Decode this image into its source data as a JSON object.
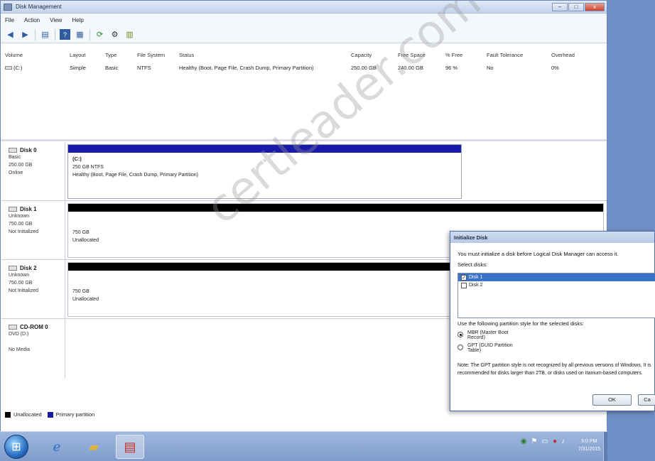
{
  "window": {
    "title": "Disk Management",
    "controls": {
      "minimize": "–",
      "maximize": "□",
      "close": "x"
    }
  },
  "menu": [
    "File",
    "Action",
    "View",
    "Help"
  ],
  "toolbar_icons": [
    "back-arrow-icon",
    "forward-arrow-icon",
    "console-tree-icon",
    "help-icon",
    "properties-icon",
    "refresh-icon",
    "settings-icon",
    "wizard-icon"
  ],
  "volumes": {
    "columns": [
      "Volume",
      "Layout",
      "Type",
      "File System",
      "Status",
      "Capacity",
      "Free Space",
      "% Free",
      "Fault Tolerance",
      "Overhead"
    ],
    "rows": [
      [
        "(C:)",
        "Simple",
        "Basic",
        "NTFS",
        "Healthy (Boot, Page File, Crash Dump, Primary Partition)",
        "250.00 GB",
        "240.00 GB",
        "96 %",
        "No",
        "0%"
      ]
    ]
  },
  "disks": [
    {
      "name": "Disk 0",
      "lines": [
        "Basic",
        "250.00 GB",
        "Online"
      ],
      "partition": {
        "title": "(C:)",
        "size": "250 GB NTFS",
        "status": "Healthy (Boot, Page File, Crash Dump, Primary Partition)"
      }
    },
    {
      "name": "Disk 1",
      "lines": [
        "Unknown",
        "750.00 GB",
        "Not Initialized"
      ],
      "partition": {
        "size": "750 GB",
        "status": "Unallocated"
      }
    },
    {
      "name": "Disk 2",
      "lines": [
        "Unknown",
        "750.00 GB",
        "Not Initialized"
      ],
      "partition": {
        "size": "750 GB",
        "status": "Unallocated"
      }
    },
    {
      "name": "CD-ROM 0",
      "lines": [
        "DVD (D:)",
        "",
        "No Media"
      ]
    }
  ],
  "legend": {
    "unallocated": "Unallocated",
    "primary": "Primary partition",
    "colors": {
      "unallocated": "#000000",
      "primary": "#1a1aa8"
    }
  },
  "watermark": "certleader.com",
  "dialog": {
    "title": "Initialize Disk",
    "intro": "You must initialize a disk before Logical Disk Manager can access it.",
    "select_label": "Select disks:",
    "disk_items": [
      {
        "label": "Disk 1",
        "checked": "✓"
      },
      {
        "label": "Disk 2",
        "checked": ""
      }
    ],
    "style_label": "Use the following partition style for the selected disks:",
    "options": [
      {
        "line1": "MBR (Master Boot",
        "line2": "Record)"
      },
      {
        "line1": "GPT (GUID Partition",
        "line2": "Table)"
      }
    ],
    "note": "Note: The GPT partition style is not recognized by all previous versions of Windows. It is recommended for disks larger than 2TB, or disks used on Itanium-based computers.",
    "ok": "OK",
    "cancel": "Ca"
  },
  "taskbar": {
    "clock_time": "5:0 PM",
    "clock_date": "7/31/2015"
  }
}
